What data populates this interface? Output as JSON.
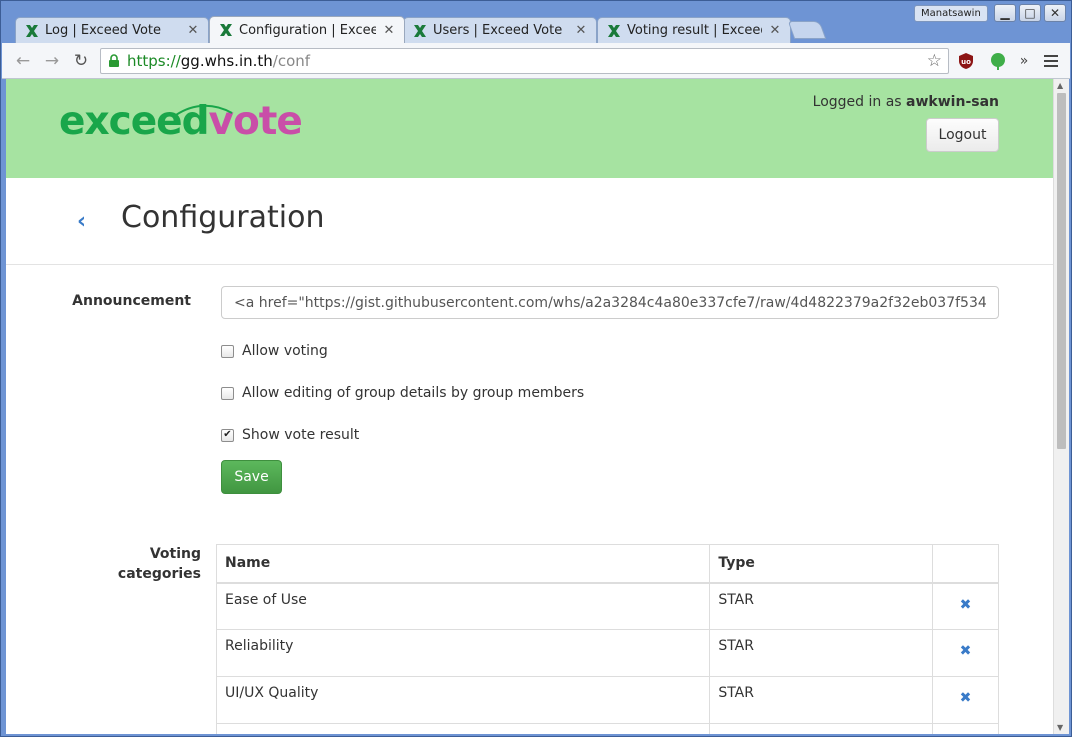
{
  "browser": {
    "tabs": [
      {
        "title": "Log | Exceed Vote",
        "active": false
      },
      {
        "title": "Configuration | Exceed Vote",
        "active": true
      },
      {
        "title": "Users | Exceed Vote",
        "active": false
      },
      {
        "title": "Voting result | Exceed Vote",
        "active": false
      }
    ],
    "profile_name": "Manatsawin",
    "url": {
      "scheme": "https://",
      "host": "gg.whs.in.th",
      "path": "/conf"
    },
    "close_glyph": "✕"
  },
  "site": {
    "logo": {
      "part1": "exceed",
      "part2": "vote"
    },
    "logged_in_prefix": "Logged in as ",
    "username": "awkwin-san",
    "logout_label": "Logout"
  },
  "page": {
    "title": "Configuration",
    "announcement_label": "Announcement",
    "announcement_value": "<a href=\"https://gist.githubusercontent.com/whs/a2a3284c4a80e337cfe7/raw/4d4822379a2f32eb037f534",
    "checkboxes": [
      {
        "label": "Allow voting",
        "checked": false
      },
      {
        "label": "Allow editing of group details by group members",
        "checked": false
      },
      {
        "label": "Show vote result",
        "checked": true
      }
    ],
    "save_label": "Save",
    "categories_label_line1": "Voting",
    "categories_label_line2": "categories",
    "table": {
      "headers": [
        "Name",
        "Type",
        ""
      ],
      "rows": [
        {
          "name": "Ease of Use",
          "type": "STAR"
        },
        {
          "name": "Reliability",
          "type": "STAR"
        },
        {
          "name": "UI/UX Quality",
          "type": "STAR"
        }
      ]
    }
  },
  "colors": {
    "header_bg": "#a6e3a1",
    "logo_green": "#19a64a",
    "logo_pink": "#c94ea8",
    "save_green": "#5cb85c",
    "link_blue": "#3a7bc8"
  }
}
